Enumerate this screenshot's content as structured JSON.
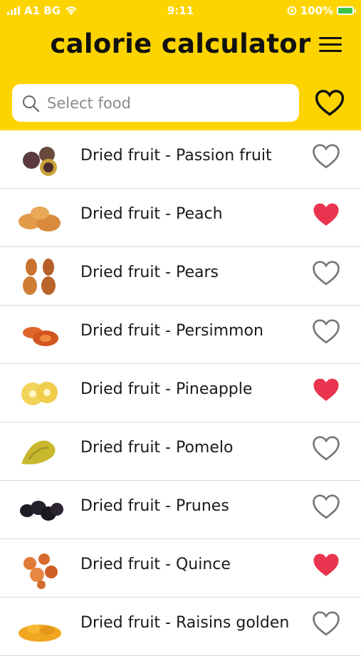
{
  "status_bar": {
    "carrier": "A1 BG",
    "time": "9:11",
    "battery": "100%"
  },
  "header": {
    "title": "calorie calculator"
  },
  "search": {
    "placeholder": "Select food"
  },
  "colors": {
    "header_bg": "#fed400",
    "favorite_on": "#e8344e",
    "favorite_off": "#777777"
  },
  "foods": [
    {
      "label": "Dried fruit - Passion fruit",
      "favorite": false
    },
    {
      "label": "Dried fruit - Peach",
      "favorite": true
    },
    {
      "label": "Dried fruit - Pears",
      "favorite": false
    },
    {
      "label": "Dried fruit - Persimmon",
      "favorite": false
    },
    {
      "label": "Dried fruit - Pineapple",
      "favorite": true
    },
    {
      "label": "Dried fruit - Pomelo",
      "favorite": false
    },
    {
      "label": "Dried fruit - Prunes",
      "favorite": false
    },
    {
      "label": "Dried fruit - Quince",
      "favorite": true
    },
    {
      "label": "Dried fruit - Raisins golden",
      "favorite": false
    }
  ]
}
